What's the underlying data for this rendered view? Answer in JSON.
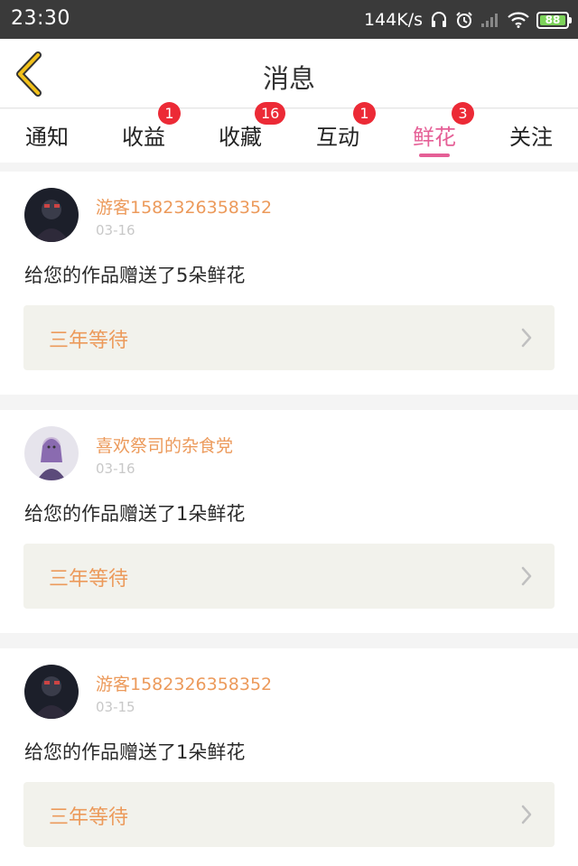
{
  "status_bar": {
    "time": "23:30",
    "net_speed": "144K/s",
    "battery": "88",
    "icons": [
      "headset-icon",
      "alarm-icon",
      "signal-icon",
      "wifi-icon",
      "battery-icon"
    ]
  },
  "header": {
    "title": "消息",
    "back_icon": "chevron-left-icon"
  },
  "tabs": [
    {
      "label": "通知",
      "badge": ""
    },
    {
      "label": "收益",
      "badge": "1"
    },
    {
      "label": "收藏",
      "badge": "16"
    },
    {
      "label": "互动",
      "badge": "1"
    },
    {
      "label": "鲜花",
      "badge": "3",
      "active": true
    },
    {
      "label": "关注",
      "badge": ""
    }
  ],
  "messages": [
    {
      "username": "游客1582326358352",
      "date": "03-16",
      "text": "给您的作品赠送了5朵鲜花",
      "work_title": "三年等待"
    },
    {
      "username": "喜欢祭司的杂食党",
      "date": "03-16",
      "text": "给您的作品赠送了1朵鲜花",
      "work_title": "三年等待"
    },
    {
      "username": "游客1582326358352",
      "date": "03-15",
      "text": "给您的作品赠送了1朵鲜花",
      "work_title": "三年等待"
    }
  ],
  "colors": {
    "accent": "#e55f96",
    "username": "#ec9a5b",
    "badge": "#ec2a36",
    "back_arrow": "#f2c11a"
  }
}
